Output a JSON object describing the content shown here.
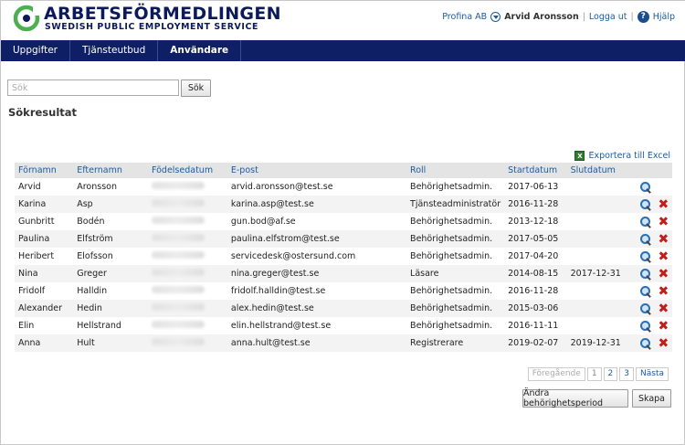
{
  "header": {
    "logo_name": "ARBETSFÖRMEDLINGEN",
    "logo_sub": "SWEDISH PUBLIC EMPLOYMENT SERVICE",
    "org": "Profina AB",
    "user": "Arvid Aronsson",
    "logout": "Logga ut",
    "help": "Hjälp",
    "separator": "|"
  },
  "nav": {
    "items": [
      {
        "label": "Uppgifter"
      },
      {
        "label": "Tjänsteutbud"
      },
      {
        "label": "Användare"
      }
    ],
    "active": "Användare"
  },
  "search": {
    "placeholder": "Sök",
    "value": "",
    "button": "Sök"
  },
  "results": {
    "title": "Sökresultat",
    "export": "Exportera till Excel",
    "columns": [
      "Förnamn",
      "Efternamn",
      "Födelsedatum",
      "E-post",
      "Roll",
      "Startdatum",
      "Slutdatum"
    ],
    "rows": [
      {
        "first": "Arvid",
        "last": "Aronsson",
        "email": "arvid.aronsson@test.se",
        "role": "Behörighetsadmin.",
        "start": "2017-06-13",
        "end": "",
        "deletable": false
      },
      {
        "first": "Karina",
        "last": "Asp",
        "email": "karina.asp@test.se",
        "role": "Tjänsteadministratör",
        "start": "2016-11-28",
        "end": "",
        "deletable": true
      },
      {
        "first": "Gunbritt",
        "last": "Bodén",
        "email": "gun.bod@af.se",
        "role": "Behörighetsadmin.",
        "start": "2013-12-18",
        "end": "",
        "deletable": true
      },
      {
        "first": "Paulina",
        "last": "Elfström",
        "email": "paulina.elfstrom@test.se",
        "role": "Behörighetsadmin.",
        "start": "2017-05-05",
        "end": "",
        "deletable": true
      },
      {
        "first": "Heribert",
        "last": "Elofsson",
        "email": "servicedesk@ostersund.com",
        "role": "Behörighetsadmin.",
        "start": "2017-04-20",
        "end": "",
        "deletable": true
      },
      {
        "first": "Nina",
        "last": "Greger",
        "email": "nina.greger@test.se",
        "role": "Läsare",
        "start": "2014-08-15",
        "end": "2017-12-31",
        "deletable": true
      },
      {
        "first": "Fridolf",
        "last": "Halldin",
        "email": "fridolf.halldin@test.se",
        "role": "Behörighetsadmin.",
        "start": "2016-11-28",
        "end": "",
        "deletable": true
      },
      {
        "first": "Alexander",
        "last": "Hedin",
        "email": "alex.hedin@test.se",
        "role": "Behörighetsadmin.",
        "start": "2015-03-06",
        "end": "",
        "deletable": true
      },
      {
        "first": "Elin",
        "last": "Hellstrand",
        "email": "elin.hellstrand@test.se",
        "role": "Behörighetsadmin.",
        "start": "2016-11-11",
        "end": "",
        "deletable": true
      },
      {
        "first": "Anna",
        "last": "Hult",
        "email": "anna.hult@test.se",
        "role": "Registrerare",
        "start": "2019-02-07",
        "end": "2019-12-31",
        "deletable": true
      }
    ]
  },
  "pager": {
    "prev": "Föregående",
    "pages": [
      "1",
      "2",
      "3"
    ],
    "current": "1",
    "next": "Nästa"
  },
  "actions": {
    "change_period": "Ändra behörighetsperiod",
    "create": "Skapa"
  },
  "icons": {
    "logo": "af-logo-icon",
    "org_switch": "chevron-circle-icon",
    "help": "help-icon",
    "excel": "excel-icon",
    "view": "magnifier-icon",
    "delete": "delete-x-icon"
  },
  "colors": {
    "nav_bg": "#0f1f66",
    "brand": "#0d1a5a",
    "logo_green": "#4caf50",
    "link": "#1a5c9e",
    "delete": "#c0201c"
  }
}
